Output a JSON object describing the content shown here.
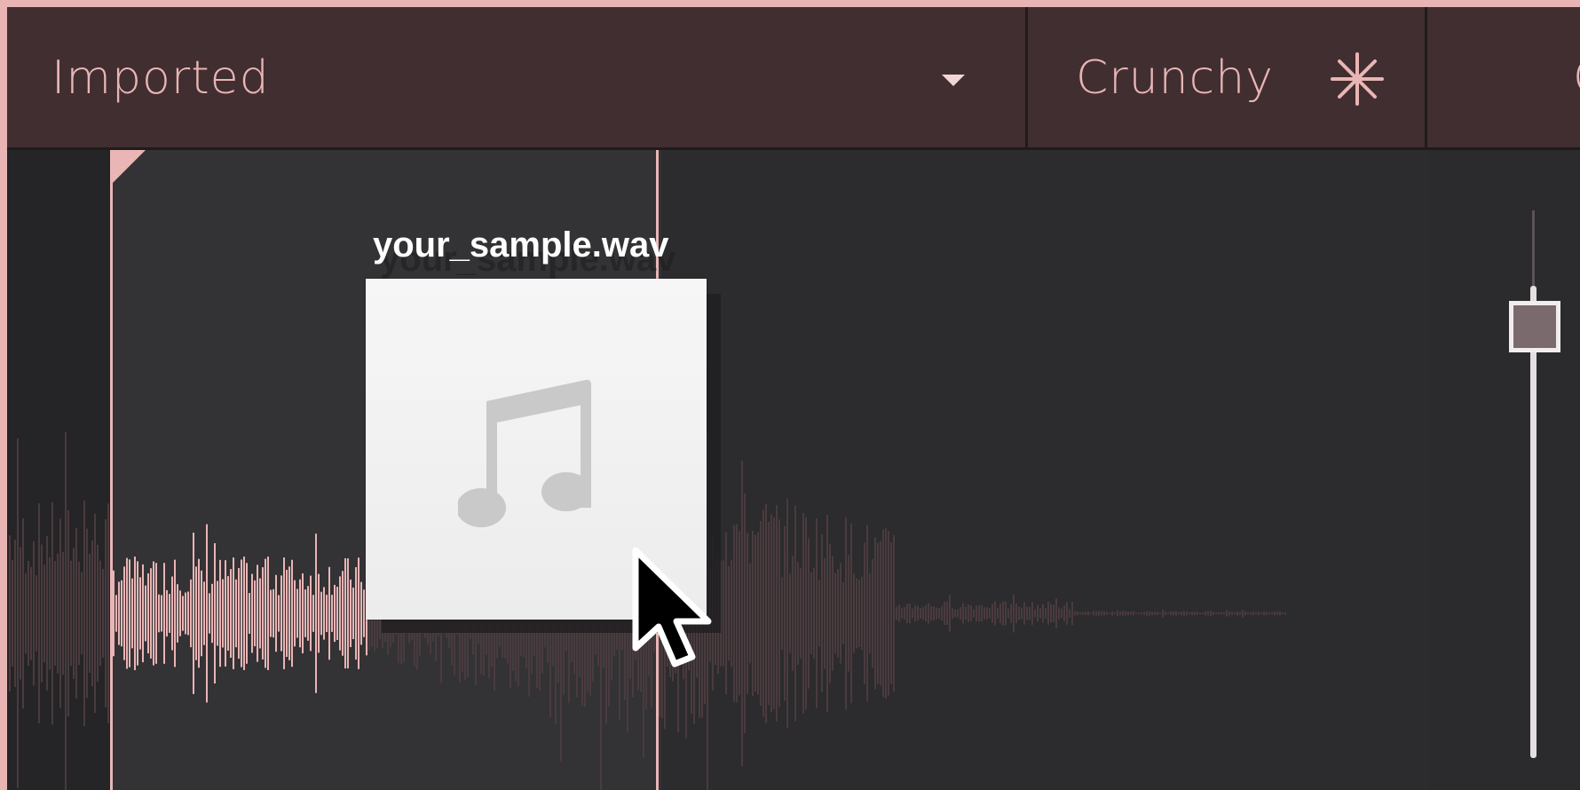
{
  "header": {
    "preset_select": {
      "value": "Imported",
      "icon": "chevron-down-icon"
    },
    "mode": {
      "label": "Crunchy",
      "icon": "asterisk-icon"
    },
    "next_section": {
      "label": "C"
    }
  },
  "drag": {
    "file_name": "your_sample.wav",
    "file_icon": "music-note-icon",
    "cursor": "arrow-cursor-icon"
  },
  "slider": {
    "value_fraction": 0.04
  },
  "colors": {
    "accent": "#e9b5b5",
    "header_bg": "#412e30",
    "panel_bg": "#2d2c2e",
    "waveform_dim": "#4a3b3e"
  }
}
